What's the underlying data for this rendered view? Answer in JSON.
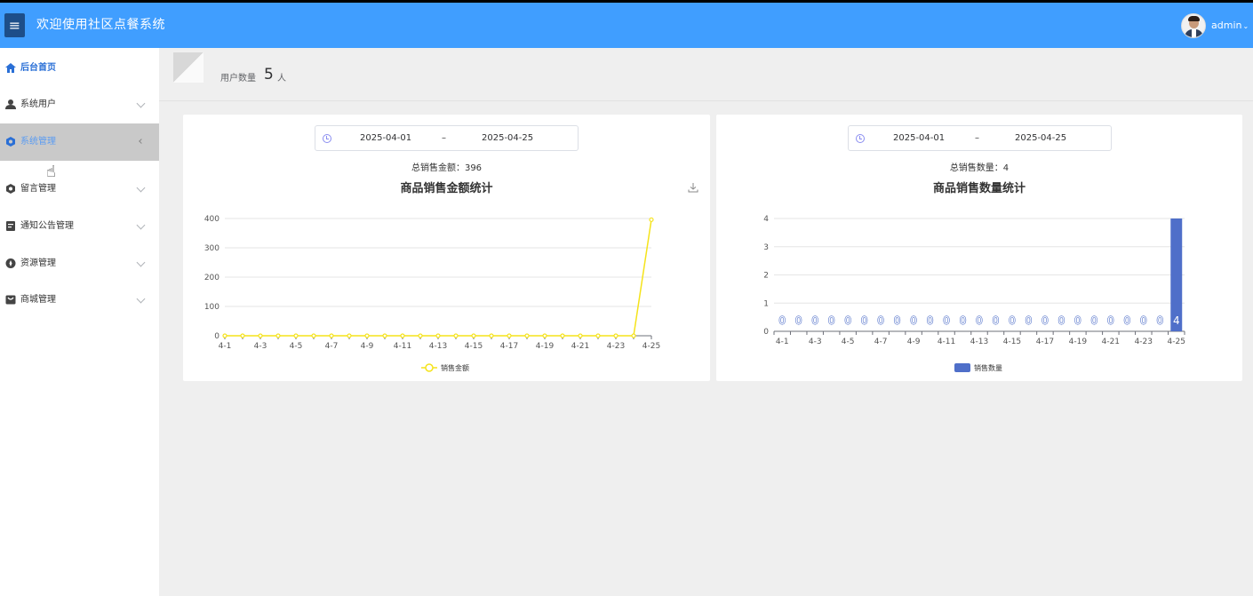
{
  "header": {
    "menu_icon": "hamburger-icon",
    "title": "欢迎使用社区点餐系统",
    "username": "admin",
    "caret": "⌄"
  },
  "sidebar": {
    "items": [
      {
        "label": "后台首页",
        "icon": "home-icon"
      },
      {
        "label": "系统用户",
        "icon": "user-icon"
      },
      {
        "label": "系统管理",
        "icon": "settings-icon"
      },
      {
        "label": "留言管理",
        "icon": "settings-icon"
      },
      {
        "label": "通知公告管理",
        "icon": "notice-icon"
      },
      {
        "label": "资源管理",
        "icon": "compass-icon"
      },
      {
        "label": "商城管理",
        "icon": "mall-icon"
      }
    ],
    "accent_color": "#2a6fd6"
  },
  "user_count": {
    "label": "用户数量",
    "value": "5",
    "unit": "人"
  },
  "sales_amount_panel": {
    "date_start": "2025-04-01",
    "date_sep": "–",
    "date_end": "2025-04-25",
    "summary": "总销售金额：396"
  },
  "sales_count_panel": {
    "date_start": "2025-04-01",
    "date_sep": "–",
    "date_end": "2025-04-25",
    "summary": "总销售数量：4"
  },
  "chart_data": [
    {
      "type": "line",
      "title": "商品销售金额统计",
      "x": [
        "4-1",
        "4-2",
        "4-3",
        "4-4",
        "4-5",
        "4-6",
        "4-7",
        "4-8",
        "4-9",
        "4-10",
        "4-11",
        "4-12",
        "4-13",
        "4-14",
        "4-15",
        "4-16",
        "4-17",
        "4-18",
        "4-19",
        "4-20",
        "4-21",
        "4-22",
        "4-23",
        "4-24",
        "4-25"
      ],
      "xtick_labels": [
        "4-1",
        "4-3",
        "4-5",
        "4-7",
        "4-9",
        "4-11",
        "4-13",
        "4-15",
        "4-17",
        "4-19",
        "4-21",
        "4-23",
        "4-25"
      ],
      "series": [
        {
          "name": "销售金额",
          "color": "#f5e31a",
          "values": [
            0,
            0,
            0,
            0,
            0,
            0,
            0,
            0,
            0,
            0,
            0,
            0,
            0,
            0,
            0,
            0,
            0,
            0,
            0,
            0,
            0,
            0,
            0,
            0,
            396
          ]
        }
      ],
      "ylim": [
        0,
        400
      ],
      "yticks": [
        0,
        100,
        200,
        300,
        400
      ],
      "grid": true,
      "legend": "bottom-center"
    },
    {
      "type": "bar",
      "title": "商品销售数量统计",
      "x": [
        "4-1",
        "4-2",
        "4-3",
        "4-4",
        "4-5",
        "4-6",
        "4-7",
        "4-8",
        "4-9",
        "4-10",
        "4-11",
        "4-12",
        "4-13",
        "4-14",
        "4-15",
        "4-16",
        "4-17",
        "4-18",
        "4-19",
        "4-20",
        "4-21",
        "4-22",
        "4-23",
        "4-24",
        "4-25"
      ],
      "xtick_labels": [
        "4-1",
        "4-3",
        "4-5",
        "4-7",
        "4-9",
        "4-11",
        "4-13",
        "4-15",
        "4-17",
        "4-19",
        "4-21",
        "4-23",
        "4-25"
      ],
      "series": [
        {
          "name": "销售数量",
          "color": "#4f6fc9",
          "values": [
            0,
            0,
            0,
            0,
            0,
            0,
            0,
            0,
            0,
            0,
            0,
            0,
            0,
            0,
            0,
            0,
            0,
            0,
            0,
            0,
            0,
            0,
            0,
            0,
            4
          ]
        }
      ],
      "ylim": [
        0,
        4
      ],
      "yticks": [
        0,
        1,
        2,
        3,
        4
      ],
      "data_labels": true,
      "grid": true,
      "legend": "bottom-center"
    }
  ]
}
